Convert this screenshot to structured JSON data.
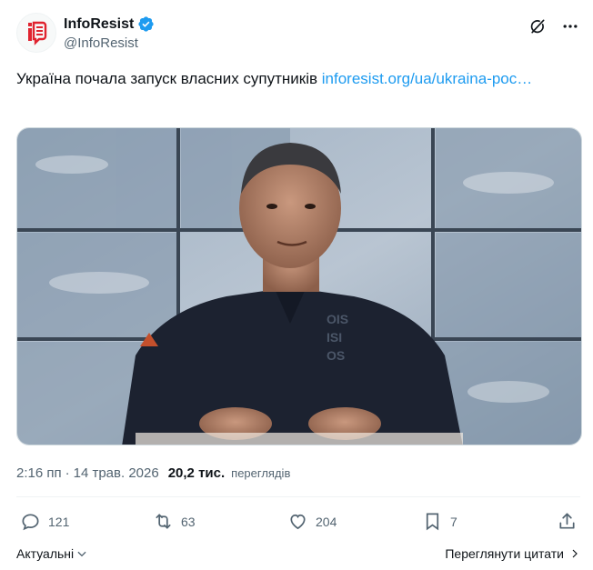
{
  "account": {
    "display_name": "InfoResist",
    "handle": "@InfoResist",
    "verified": true
  },
  "tweet": {
    "text": "Україна почала запуск власних супутників ",
    "link": "inforesist.org/ua/ukraina-рос…"
  },
  "media": {
    "alt": "photo"
  },
  "meta": {
    "time": "2:16 пп",
    "separator": "·",
    "date": "14 трав. 2026",
    "views_count": "20,2 тис.",
    "views_label": "переглядів"
  },
  "actions": {
    "replies": "121",
    "reposts": "63",
    "likes": "204",
    "bookmarks": "7"
  },
  "footer": {
    "sort_label": "Актуальні",
    "quotes_label": "Переглянути цитати"
  },
  "colors": {
    "link": "#1d9bf0",
    "verified": "#1d9bf0",
    "text": "#0f1419",
    "secondary": "#536471",
    "logo_red": "#e0232f"
  },
  "icons": {
    "more": "more-icon",
    "grok": "grok-icon",
    "reply": "reply-icon",
    "repost": "repost-icon",
    "like": "like-icon",
    "bookmark": "bookmark-icon",
    "share": "share-icon"
  }
}
